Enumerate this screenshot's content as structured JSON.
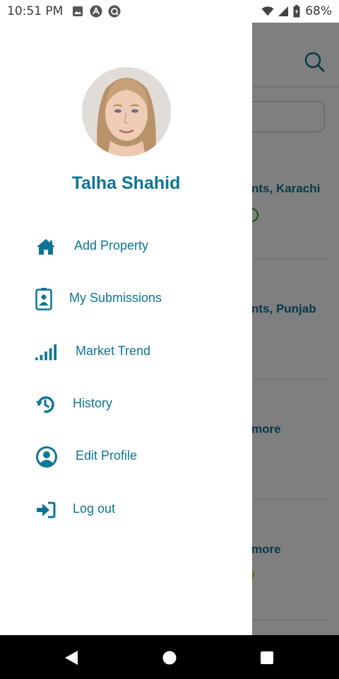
{
  "status_bar": {
    "time": "10:51 PM",
    "battery": "68%",
    "icons": [
      "image-icon",
      "arch-icon",
      "sync-icon",
      "wifi-icon",
      "signal-icon",
      "battery-icon"
    ]
  },
  "drawer": {
    "user_name": "Talha Shahid",
    "menu": [
      {
        "label": "Add Property",
        "icon": "home-icon"
      },
      {
        "label": "My Submissions",
        "icon": "id-badge-icon"
      },
      {
        "label": "Market Trend",
        "icon": "signal-bars-icon"
      },
      {
        "label": "History",
        "icon": "history-icon"
      },
      {
        "label": "Edit Profile",
        "icon": "user-circle-icon"
      },
      {
        "label": "Log out",
        "icon": "logout-icon"
      }
    ]
  },
  "background": {
    "items": [
      "nts, Karachi",
      "nts, Punjab",
      "more",
      "more"
    ]
  },
  "nav_bar": {
    "buttons": [
      "back-icon",
      "home-circle-icon",
      "recents-square-icon"
    ]
  },
  "colors": {
    "accent": "#0e7595",
    "scrim": "rgba(0,0,0,0.5)",
    "nav_bg": "#000000"
  }
}
